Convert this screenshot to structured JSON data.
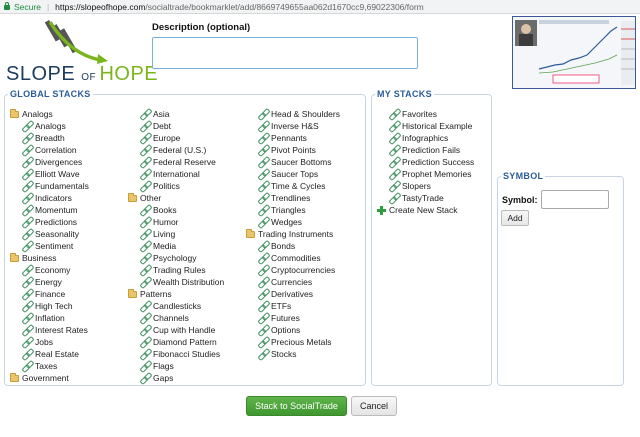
{
  "browser": {
    "secure_label": "Secure",
    "url_host": "https://slopeofhope.com",
    "url_path": "/socialtrade/bookmarklet/add/8669749655aa062d1670cc9,69022306/form"
  },
  "logo": {
    "slope": "SLOPE ",
    "of": "OF ",
    "hope": "HOPE"
  },
  "description": {
    "label": "Description (optional)",
    "value": ""
  },
  "global_stacks": {
    "title": "GLOBAL STACKS",
    "columns": [
      [
        {
          "type": "folder",
          "label": "Analogs"
        },
        {
          "type": "link",
          "label": "Analogs"
        },
        {
          "type": "link",
          "label": "Breadth"
        },
        {
          "type": "link",
          "label": "Correlation"
        },
        {
          "type": "link",
          "label": "Divergences"
        },
        {
          "type": "link",
          "label": "Elliott Wave"
        },
        {
          "type": "link",
          "label": "Fundamentals"
        },
        {
          "type": "link",
          "label": "Indicators"
        },
        {
          "type": "link",
          "label": "Momentum"
        },
        {
          "type": "link",
          "label": "Predictions"
        },
        {
          "type": "link",
          "label": "Seasonality"
        },
        {
          "type": "link",
          "label": "Sentiment"
        },
        {
          "type": "folder",
          "label": "Business"
        },
        {
          "type": "link",
          "label": "Economy"
        },
        {
          "type": "link",
          "label": "Energy"
        },
        {
          "type": "link",
          "label": "Finance"
        },
        {
          "type": "link",
          "label": "High Tech"
        },
        {
          "type": "link",
          "label": "Inflation"
        },
        {
          "type": "link",
          "label": "Interest Rates"
        },
        {
          "type": "link",
          "label": "Jobs"
        },
        {
          "type": "link",
          "label": "Real Estate"
        },
        {
          "type": "link",
          "label": "Taxes"
        },
        {
          "type": "folder",
          "label": "Government"
        }
      ],
      [
        {
          "type": "link",
          "label": "Asia"
        },
        {
          "type": "link",
          "label": "Debt"
        },
        {
          "type": "link",
          "label": "Europe"
        },
        {
          "type": "link",
          "label": "Federal (U.S.)"
        },
        {
          "type": "link",
          "label": "Federal Reserve"
        },
        {
          "type": "link",
          "label": "International"
        },
        {
          "type": "link",
          "label": "Politics"
        },
        {
          "type": "folder",
          "label": "Other"
        },
        {
          "type": "link",
          "label": "Books"
        },
        {
          "type": "link",
          "label": "Humor"
        },
        {
          "type": "link",
          "label": "Living"
        },
        {
          "type": "link",
          "label": "Media"
        },
        {
          "type": "link",
          "label": "Psychology"
        },
        {
          "type": "link",
          "label": "Trading Rules"
        },
        {
          "type": "link",
          "label": "Wealth Distribution"
        },
        {
          "type": "folder",
          "label": "Patterns"
        },
        {
          "type": "link",
          "label": "Candlesticks"
        },
        {
          "type": "link",
          "label": "Channels"
        },
        {
          "type": "link",
          "label": "Cup with Handle"
        },
        {
          "type": "link",
          "label": "Diamond Pattern"
        },
        {
          "type": "link",
          "label": "Fibonacci Studies"
        },
        {
          "type": "link",
          "label": "Flags"
        },
        {
          "type": "link",
          "label": "Gaps"
        }
      ],
      [
        {
          "type": "link",
          "label": "Head & Shoulders"
        },
        {
          "type": "link",
          "label": "Inverse H&S"
        },
        {
          "type": "link",
          "label": "Pennants"
        },
        {
          "type": "link",
          "label": "Pivot Points"
        },
        {
          "type": "link",
          "label": "Saucer Bottoms"
        },
        {
          "type": "link",
          "label": "Saucer Tops"
        },
        {
          "type": "link",
          "label": "Time & Cycles"
        },
        {
          "type": "link",
          "label": "Trendlines"
        },
        {
          "type": "link",
          "label": "Triangles"
        },
        {
          "type": "link",
          "label": "Wedges"
        },
        {
          "type": "folder",
          "label": "Trading Instruments"
        },
        {
          "type": "link",
          "label": "Bonds"
        },
        {
          "type": "link",
          "label": "Commodities"
        },
        {
          "type": "link",
          "label": "Cryptocurrencies"
        },
        {
          "type": "link",
          "label": "Currencies"
        },
        {
          "type": "link",
          "label": "Derivatives"
        },
        {
          "type": "link",
          "label": "ETFs"
        },
        {
          "type": "link",
          "label": "Futures"
        },
        {
          "type": "link",
          "label": "Options"
        },
        {
          "type": "link",
          "label": "Precious Metals"
        },
        {
          "type": "link",
          "label": "Stocks"
        }
      ]
    ]
  },
  "my_stacks": {
    "title": "MY STACKS",
    "items": [
      {
        "type": "link",
        "label": "Favorites"
      },
      {
        "type": "link",
        "label": "Historical Example"
      },
      {
        "type": "link",
        "label": "Infographics"
      },
      {
        "type": "link",
        "label": "Prediction Fails"
      },
      {
        "type": "link",
        "label": "Prediction Success"
      },
      {
        "type": "link",
        "label": "Prophet Memories"
      },
      {
        "type": "link",
        "label": "Slopers"
      },
      {
        "type": "link",
        "label": "TastyTrade"
      },
      {
        "type": "plus",
        "label": "Create New Stack"
      }
    ]
  },
  "symbol": {
    "title": "SYMBOL",
    "label": "Symbol:",
    "value": "",
    "add_label": "Add"
  },
  "actions": {
    "submit_label": "Stack to SocialTrade",
    "cancel_label": "Cancel"
  },
  "colors": {
    "accent": "#2b5c9a",
    "submit": "#4aa33a",
    "folder": "#e9c46a",
    "link_icon": "#3e8f5f"
  }
}
